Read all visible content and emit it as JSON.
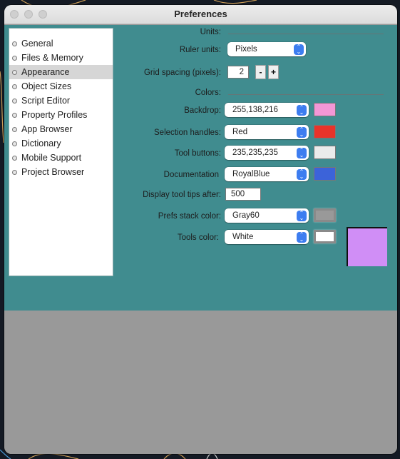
{
  "window": {
    "title": "Preferences"
  },
  "sidebar": {
    "items": [
      {
        "label": "General",
        "selected": false
      },
      {
        "label": "Files & Memory",
        "selected": false
      },
      {
        "label": "Appearance",
        "selected": true
      },
      {
        "label": "Object Sizes",
        "selected": false
      },
      {
        "label": "Script Editor",
        "selected": false
      },
      {
        "label": "Property Profiles",
        "selected": false
      },
      {
        "label": "App Browser",
        "selected": false
      },
      {
        "label": "Dictionary",
        "selected": false
      },
      {
        "label": "Mobile Support",
        "selected": false
      },
      {
        "label": "Project Browser",
        "selected": false
      }
    ]
  },
  "units": {
    "section_label": "Units:",
    "ruler_units_label": "Ruler units:",
    "ruler_units_value": "Pixels",
    "grid_spacing_label": "Grid spacing (pixels):",
    "grid_spacing_value": "2",
    "decrement_label": "-",
    "increment_label": "+"
  },
  "colors": {
    "section_label": "Colors:",
    "backdrop": {
      "label": "Backdrop:",
      "value": "255,138,216",
      "swatch": "#f397d6"
    },
    "selection_handles": {
      "label": "Selection handles:",
      "value": "Red",
      "swatch": "#e8332a"
    },
    "tool_buttons": {
      "label": "Tool buttons:",
      "value": "235,235,235",
      "swatch": "#ebebeb"
    },
    "documentation": {
      "label": "Documentation",
      "value": "RoyalBlue",
      "swatch": "#3c63d9"
    },
    "tooltips": {
      "label": "Display tool tips after:",
      "value": "500"
    },
    "prefs_stack": {
      "label": "Prefs stack color:",
      "value": "Gray60",
      "swatch": "#999999"
    },
    "tools_color": {
      "label": "Tools color:",
      "value": "White",
      "swatch": "#ffffff"
    },
    "preview_swatch": "#d08ef6"
  },
  "theme": {
    "content_bg": "#408c8f",
    "bottom_bg": "#999999",
    "stepper_blue": "#3d7df0"
  }
}
